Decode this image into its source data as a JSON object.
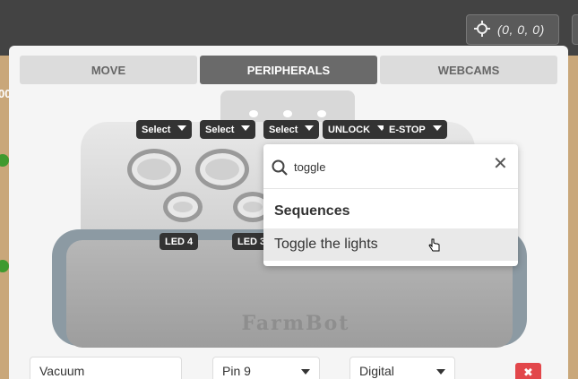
{
  "header": {
    "location_readout": "(0, 0, 0)",
    "location_icon": "crosshair-icon"
  },
  "map": {
    "edge_label": "00"
  },
  "tabs": [
    {
      "label": "MOVE",
      "active": false
    },
    {
      "label": "PERIPHERALS",
      "active": true
    },
    {
      "label": "WEBCAMS",
      "active": false
    }
  ],
  "controls": {
    "selects": [
      "Select",
      "Select",
      "Select"
    ],
    "unlock_label": "UNLOCK",
    "estop_label": "E-STOP",
    "led_labels": [
      "LED 4",
      "LED 3"
    ]
  },
  "illustration": {
    "logo_text": "FarmBot"
  },
  "search": {
    "value": "toggle",
    "icon": "search-icon",
    "clear_icon": "close-icon",
    "section_title": "Sequences",
    "results": [
      "Toggle the lights"
    ]
  },
  "peripheral_row": {
    "name": "Vacuum",
    "pin": "Pin 9",
    "mode": "Digital",
    "delete_icon": "delete-icon"
  },
  "colors": {
    "active_tab": "#6a6a6a",
    "chip_bg": "#333333",
    "delete_red": "#e2474b",
    "plant_green": "#3f9a2f"
  }
}
